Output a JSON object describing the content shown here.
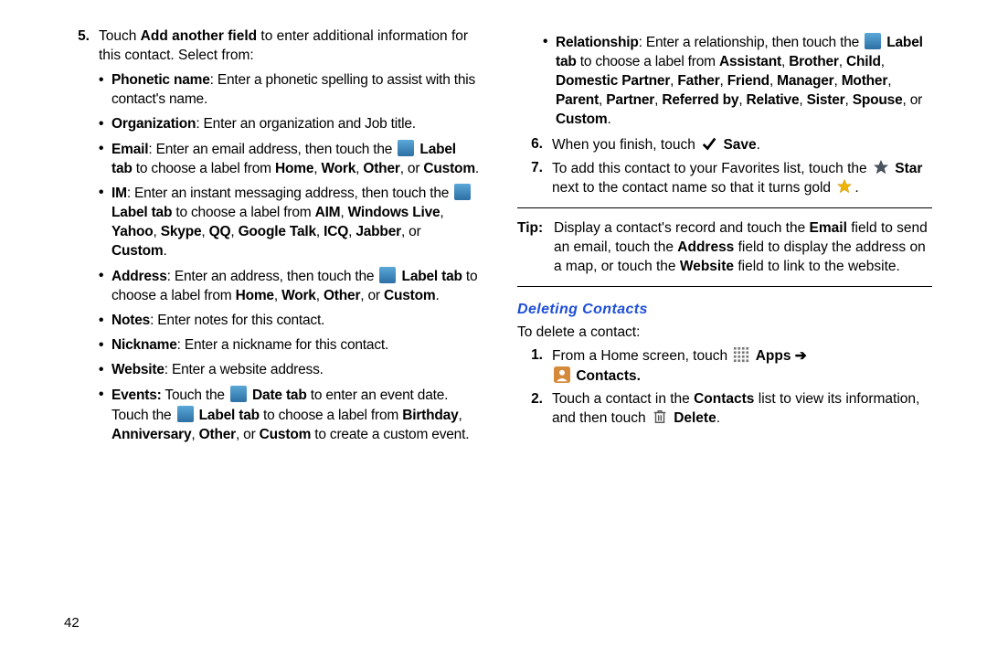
{
  "page_number": "42",
  "left": {
    "step5": {
      "num": "5.",
      "lead_a": "Touch ",
      "lead_b": "Add another field",
      "lead_c": " to enter additional information for this contact. Select from:"
    },
    "bullets": {
      "phonetic": {
        "t": "Phonetic name",
        "d": ": Enter a phonetic spelling to assist with this contact's name."
      },
      "org": {
        "t": "Organization",
        "d": ": Enter an organization and Job title."
      },
      "email": {
        "t": "Email",
        "p1": ": Enter an email address, then touch the ",
        "p2": " Label tab",
        "p3": " to choose a label from ",
        "o1": "Home",
        "o2": "Work",
        "o3": "Other",
        "o4": "Custom",
        "end": "."
      },
      "im": {
        "t": "IM",
        "p1": ": Enter an instant messaging address, then touch the ",
        "p2": "Label tab",
        "p3": " to choose a label from ",
        "o1": "AIM",
        "o2": "Windows Live",
        "o3": "Yahoo",
        "o4": "Skype",
        "o5": "QQ",
        "o6": "Google Talk",
        "o7": "ICQ",
        "o8": "Jabber",
        "o9": "Custom",
        "end": "."
      },
      "address": {
        "t": "Address",
        "p1": ": Enter an address, then touch the ",
        "p2": " Label tab",
        "p3": " to choose a label from ",
        "o1": "Home",
        "o2": "Work",
        "o3": "Other",
        "o4": "Custom",
        "end": "."
      },
      "notes": {
        "t": "Notes",
        "d": ": Enter notes for this contact."
      },
      "nickname": {
        "t": "Nickname",
        "d": ": Enter a nickname for this contact."
      },
      "website": {
        "t": "Website",
        "d": ": Enter a website address."
      },
      "events": {
        "t": "Events:",
        "p1": " Touch the ",
        "p2": " Date tab",
        "p3": " to enter an event date. Touch the ",
        "p4": " Label tab",
        "p5": " to choose a label from ",
        "o1": "Birthday",
        "o2": "Anniversary",
        "o3": "Other",
        "o4": "Custom",
        "end": " to create a custom event."
      }
    }
  },
  "right": {
    "rel": {
      "t": "Relationship",
      "p1": ": Enter a relationship, then touch the ",
      "p2": " Label tab",
      "p3": " to choose a label from ",
      "o1": "Assistant",
      "o2": "Brother",
      "o3": "Child",
      "o4": "Domestic Partner",
      "o5": "Father",
      "o6": "Friend",
      "o7": "Manager",
      "o8": "Mother",
      "o9": "Parent",
      "o10": "Partner",
      "o11": "Referred by",
      "o12": "Relative",
      "o13": "Sister",
      "o14": "Spouse",
      "o15": "Custom",
      "end": "."
    },
    "step6": {
      "num": "6.",
      "a": "When you finish, touch ",
      "b": "Save",
      "end": "."
    },
    "step7": {
      "num": "7.",
      "a": "To add this contact to your Favorites list, touch the ",
      "b": "Star",
      "c": " next to the contact name so that it turns gold ",
      "end": "."
    },
    "tip": {
      "lbl": "Tip:",
      "a": "Display a contact's record and touch the ",
      "b1": "Email",
      "c": " field to send an email, touch the ",
      "b2": "Address",
      "d": " field to display the address on a map, or touch the ",
      "b3": "Website",
      "e": " field to link to the website."
    },
    "deleting": {
      "title": "Deleting Contacts",
      "intro": "To delete a contact:",
      "s1": {
        "num": "1.",
        "a": "From a Home screen, touch ",
        "b": "Apps",
        "arrow": " ➔ ",
        "c": "Contacts."
      },
      "s2": {
        "num": "2.",
        "a": "Touch a contact in the ",
        "b1": "Contacts",
        "c": " list to view its information, and then touch ",
        "b2": "Delete",
        "end": "."
      }
    }
  }
}
